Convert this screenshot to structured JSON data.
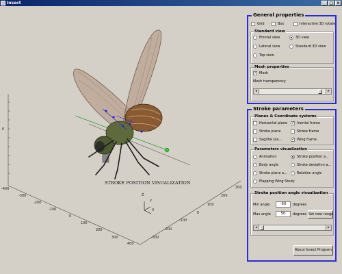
{
  "window": {
    "title": "Insect"
  },
  "plot": {
    "title": "STROKE POSITION VISUALIZATION",
    "z_ticks": [
      "0"
    ],
    "x_ticks": [
      "-400",
      "-300",
      "-200",
      "-100",
      "0",
      "100",
      "200",
      "300",
      "400"
    ],
    "y_ticks": [
      "-300",
      "-200",
      "-100",
      "0",
      "100",
      "200",
      "300"
    ],
    "axes_labels": {
      "z": "Z",
      "y": "Y",
      "x": "X"
    }
  },
  "general": {
    "title": "General properties",
    "grid": {
      "label": "Grid",
      "checked": false
    },
    "box": {
      "label": "Box",
      "checked": false
    },
    "rotate": {
      "label": "Interactive 3D rotate",
      "checked": false
    },
    "standard_view": {
      "title": "Standard view",
      "frontal": "Frontal view",
      "view3d": "3D view",
      "lateral": "Lateral view",
      "std3d": "Standard 3D view",
      "top": "Top view",
      "selected": "3D view"
    },
    "mesh": {
      "title": "Mesh properties",
      "mesh_label": "Mesh",
      "mesh_checked": true,
      "transparency_label": "Mesh transparency",
      "transparency_value": 0.9
    }
  },
  "stroke": {
    "title": "Stroke parameters",
    "planes": {
      "title": "Planes & Coordinate systems",
      "horizontal": {
        "label": "Horizontal plane",
        "checked": false
      },
      "inertial": {
        "label": "Inertial frame",
        "checked": true
      },
      "stroke_plane": {
        "label": "Stroke plane",
        "checked": false
      },
      "stroke_frame": {
        "label": "Stroke frame",
        "checked": false
      },
      "sagittal": {
        "label": "Sagittal pla...",
        "checked": false
      },
      "wing_frame": {
        "label": "Wing frame",
        "checked": true
      }
    },
    "viz": {
      "title": "Parameters visualization",
      "animation": "Animation",
      "stroke_position": "Stroke position a...",
      "body_angle": "Body angle",
      "stroke_deviation": "Stroke deviation a...",
      "stroke_plane_a": "Stroke plane a...",
      "rotation_angle": "Rotation angle",
      "flapping": "Flapping Wing Study",
      "selected": "Stroke position a..."
    },
    "angle": {
      "title": "Stroke position angle visualization",
      "min_label": "Min angle",
      "min_value": "-50",
      "max_label": "Max angle",
      "max_value": "50",
      "unit": "degrees",
      "set_range": "Set new range",
      "slider_value": 0.0
    },
    "about": "About Insect Program"
  },
  "colors": {
    "group_border": "#2b2bd6",
    "title_bar": "#0a246a"
  },
  "icons": {
    "app": "app-icon",
    "minimize": "minimize-icon",
    "maximize": "maximize-icon",
    "close": "close-icon"
  }
}
